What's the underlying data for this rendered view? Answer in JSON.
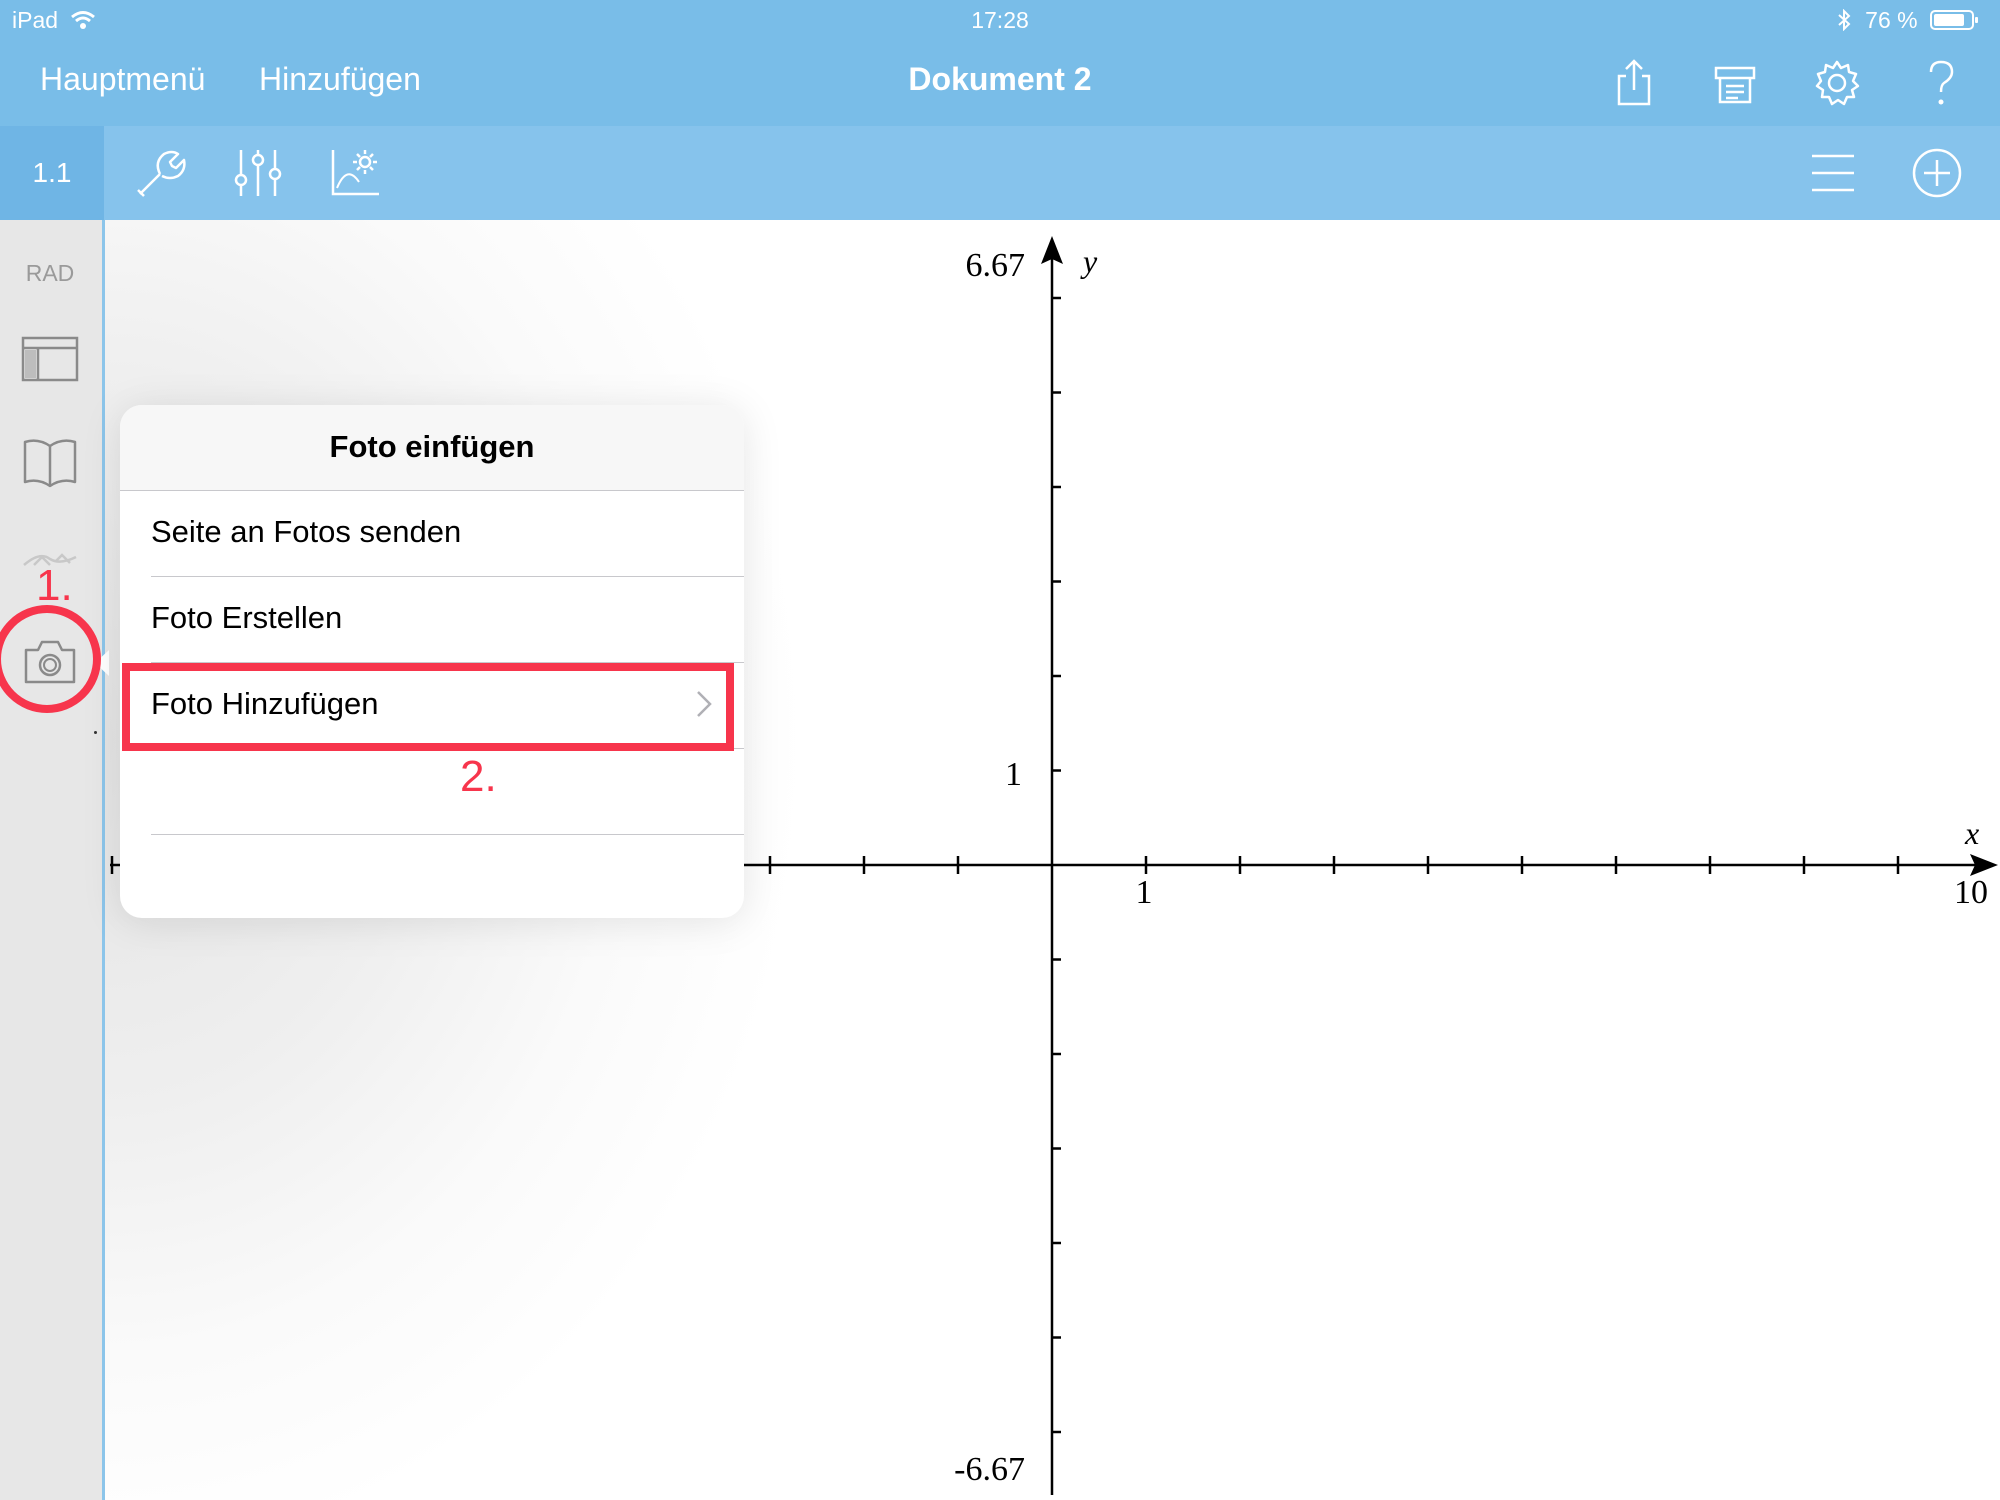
{
  "status_bar": {
    "device": "iPad",
    "time": "17:28",
    "battery_text": "76 %"
  },
  "nav": {
    "main_menu": "Hauptmenü",
    "add": "Hinzufügen",
    "title": "Dokument 2",
    "icons": [
      "share-icon",
      "document-settings-icon",
      "gear-icon",
      "help-icon"
    ]
  },
  "toolbar": {
    "page": "1.1",
    "left_icons": [
      "wrench-icon",
      "sliders-icon",
      "graph-settings-icon"
    ],
    "right_icons": [
      "menu-icon",
      "add-circle-icon"
    ]
  },
  "sidebar": {
    "angle_mode": "RAD",
    "icons": [
      "layout-icon",
      "book-icon",
      "draw-icon",
      "camera-icon"
    ]
  },
  "graph": {
    "y_max": "6.67",
    "y_min": "-6.67",
    "y_label": "y",
    "x_label": "x",
    "y_tick_one": "1",
    "x_tick_one": "1",
    "x_max": "10"
  },
  "popover": {
    "title": "Foto einfügen",
    "items": [
      {
        "label": "Seite an Fotos senden"
      },
      {
        "label": "Foto Erstellen"
      },
      {
        "label": "Foto Hinzufügen",
        "has_chevron": true
      },
      {
        "label": ""
      },
      {
        "label": ""
      }
    ]
  },
  "annotations": {
    "step1": "1.",
    "step2": "2.",
    "color": "#f7354c"
  },
  "colors": {
    "header_blue": "#79bde8",
    "toolbar_blue": "#86c3ec",
    "highlight_red": "#f7354c"
  }
}
